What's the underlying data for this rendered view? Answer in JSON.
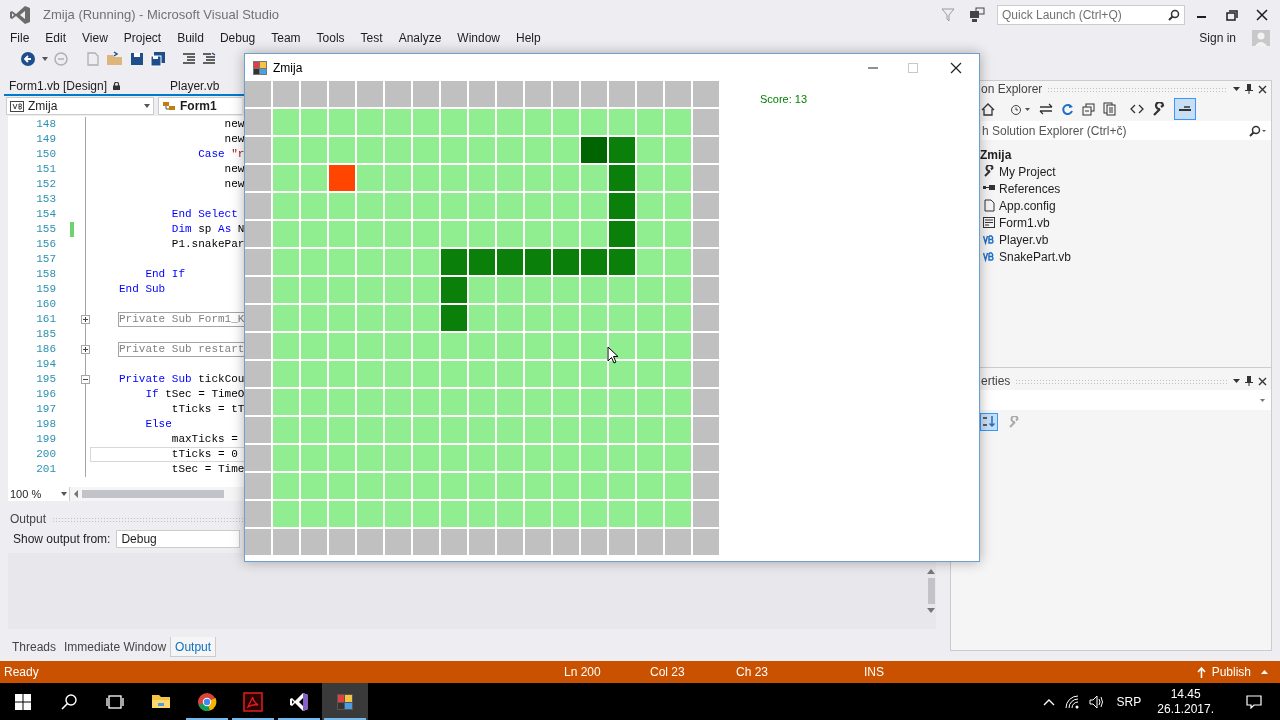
{
  "ide": {
    "title": "Zmija (Running) - Microsoft Visual Studio",
    "quick_launch": {
      "placeholder": "Quick Launch (Ctrl+Q)"
    },
    "menu": [
      "File",
      "Edit",
      "View",
      "Project",
      "Build",
      "Debug",
      "Team",
      "Tools",
      "Test",
      "Analyze",
      "Window",
      "Help"
    ],
    "sign_in": "Sign in"
  },
  "document_tabs": [
    {
      "label": "Form1.vb [Design]",
      "locked": true
    },
    {
      "label": "Player.vb",
      "locked": false
    }
  ],
  "navigation": {
    "project": "Zmija",
    "type": "Form1"
  },
  "code_lines": [
    {
      "number": "148",
      "kind": "code",
      "changed": false,
      "current": false,
      "segments": [
        {
          "kind": "plain",
          "text": "                new"
        }
      ]
    },
    {
      "number": "149",
      "kind": "code",
      "changed": false,
      "current": false,
      "segments": [
        {
          "kind": "plain",
          "text": "                new"
        }
      ]
    },
    {
      "number": "150",
      "kind": "code",
      "changed": false,
      "current": false,
      "segments": [
        {
          "kind": "kw",
          "text": "            Case "
        },
        {
          "kind": "string",
          "text": "\"r"
        }
      ]
    },
    {
      "number": "151",
      "kind": "code",
      "changed": false,
      "current": false,
      "segments": [
        {
          "kind": "plain",
          "text": "                new"
        }
      ]
    },
    {
      "number": "152",
      "kind": "code",
      "changed": false,
      "current": false,
      "segments": [
        {
          "kind": "plain",
          "text": "                new"
        }
      ]
    },
    {
      "number": "153",
      "kind": "code",
      "changed": false,
      "current": false
    },
    {
      "number": "154",
      "kind": "code",
      "changed": false,
      "current": false,
      "segments": [
        {
          "kind": "kw",
          "text": "        End Select"
        }
      ]
    },
    {
      "number": "155",
      "kind": "code",
      "changed": true,
      "current": false,
      "segments": [
        {
          "kind": "kw",
          "text": "        Dim"
        },
        {
          "kind": "plain",
          "text": " sp "
        },
        {
          "kind": "kw",
          "text": "As"
        },
        {
          "kind": "plain",
          "text": " N"
        }
      ]
    },
    {
      "number": "156",
      "kind": "code",
      "changed": false,
      "current": false,
      "segments": [
        {
          "kind": "plain",
          "text": "        P1.snakePar"
        }
      ]
    },
    {
      "number": "157",
      "kind": "code",
      "changed": false,
      "current": false
    },
    {
      "number": "158",
      "kind": "code",
      "changed": false,
      "current": false,
      "segments": [
        {
          "kind": "kw",
          "text": "    End If"
        }
      ]
    },
    {
      "number": "159",
      "kind": "code",
      "changed": false,
      "current": false,
      "segments": [
        {
          "kind": "kw",
          "text": "End Sub"
        }
      ]
    },
    {
      "number": "160",
      "kind": "code",
      "changed": false,
      "current": false
    },
    {
      "number": "161",
      "kind": "collapsed",
      "changed": false,
      "current": false,
      "text": "Private Sub Form1_K"
    },
    {
      "number": "185",
      "kind": "code",
      "changed": false,
      "current": false
    },
    {
      "number": "186",
      "kind": "collapsed",
      "changed": false,
      "current": false,
      "text": "Private Sub restart"
    },
    {
      "number": "194",
      "kind": "code",
      "changed": false,
      "current": false
    },
    {
      "number": "195",
      "kind": "region",
      "changed": false,
      "current": false,
      "segments": [
        {
          "kind": "kw",
          "text": "Private Sub"
        },
        {
          "kind": "plain",
          "text": " tickCou"
        }
      ]
    },
    {
      "number": "196",
      "kind": "code",
      "changed": false,
      "current": false,
      "segments": [
        {
          "kind": "kw",
          "text": "    If"
        },
        {
          "kind": "plain",
          "text": " tSec = TimeO"
        }
      ]
    },
    {
      "number": "197",
      "kind": "code",
      "changed": false,
      "current": false,
      "segments": [
        {
          "kind": "plain",
          "text": "        tTicks = tT"
        }
      ]
    },
    {
      "number": "198",
      "kind": "code",
      "changed": false,
      "current": false,
      "segments": [
        {
          "kind": "kw",
          "text": "    Else"
        }
      ]
    },
    {
      "number": "199",
      "kind": "code",
      "changed": false,
      "current": false,
      "segments": [
        {
          "kind": "plain",
          "text": "        maxTicks ="
        }
      ]
    },
    {
      "number": "200",
      "kind": "code",
      "changed": false,
      "current": true,
      "segments": [
        {
          "kind": "plain",
          "text": "        tTicks = 0"
        }
      ]
    },
    {
      "number": "201",
      "kind": "code",
      "changed": false,
      "current": false,
      "segments": [
        {
          "kind": "plain",
          "text": "        tSec = Time"
        }
      ]
    }
  ],
  "zoom": "100 %",
  "output": {
    "title": "Output",
    "source_label": "Show output from:",
    "source": "Debug"
  },
  "bottom_tabs": [
    {
      "label": "Threads",
      "selected": false
    },
    {
      "label": "Immediate Window",
      "selected": false
    },
    {
      "label": "Output",
      "selected": true
    }
  ],
  "solution_explorer": {
    "title": "on Explorer",
    "search": {
      "placeholder": "h Solution Explorer (Ctrl+č)"
    },
    "tree": {
      "label": "Zmija",
      "children": [
        {
          "label": "My Project",
          "kind": "settings"
        },
        {
          "label": "References",
          "kind": "references"
        },
        {
          "label": "App.config",
          "kind": "config"
        },
        {
          "label": "Form1.vb",
          "kind": "form"
        },
        {
          "label": "Player.vb",
          "kind": "vb"
        },
        {
          "label": "SnakePart.vb",
          "kind": "vb"
        }
      ]
    }
  },
  "properties": {
    "title": "erties"
  },
  "status_bar": {
    "text": "Ready",
    "line": "Ln 200",
    "column": "Col 23",
    "char": "Ch 23",
    "mode": "INS",
    "publish": "Publish"
  },
  "taskbar": {
    "apps": [
      {
        "kind": "explorer",
        "running": false,
        "active": false
      },
      {
        "kind": "chrome",
        "running": true,
        "active": false
      },
      {
        "kind": "acrobat",
        "running": true,
        "active": false
      },
      {
        "kind": "visualstudio",
        "running": true,
        "active": false
      },
      {
        "kind": "snake",
        "running": true,
        "active": true
      }
    ],
    "language": "SRP",
    "time": "14.45",
    "date": "26.1.2017."
  },
  "game_window": {
    "title": "Zmija",
    "score": "Score: 13",
    "board": [
      {
        "cells": [
          {
            "kind": "wall"
          },
          {
            "kind": "wall"
          },
          {
            "kind": "wall"
          },
          {
            "kind": "wall"
          },
          {
            "kind": "wall"
          },
          {
            "kind": "wall"
          },
          {
            "kind": "wall"
          },
          {
            "kind": "wall"
          },
          {
            "kind": "wall"
          },
          {
            "kind": "wall"
          },
          {
            "kind": "wall"
          },
          {
            "kind": "wall"
          },
          {
            "kind": "wall"
          },
          {
            "kind": "wall"
          },
          {
            "kind": "wall"
          },
          {
            "kind": "wall"
          },
          {
            "kind": "wall"
          }
        ]
      },
      {
        "cells": [
          {
            "kind": "wall"
          },
          {
            "kind": "grass"
          },
          {
            "kind": "grass"
          },
          {
            "kind": "grass"
          },
          {
            "kind": "grass"
          },
          {
            "kind": "grass"
          },
          {
            "kind": "grass"
          },
          {
            "kind": "grass"
          },
          {
            "kind": "grass"
          },
          {
            "kind": "grass"
          },
          {
            "kind": "grass"
          },
          {
            "kind": "grass"
          },
          {
            "kind": "grass"
          },
          {
            "kind": "grass"
          },
          {
            "kind": "grass"
          },
          {
            "kind": "grass"
          },
          {
            "kind": "wall"
          }
        ]
      },
      {
        "cells": [
          {
            "kind": "wall"
          },
          {
            "kind": "grass"
          },
          {
            "kind": "grass"
          },
          {
            "kind": "grass"
          },
          {
            "kind": "grass"
          },
          {
            "kind": "grass"
          },
          {
            "kind": "grass"
          },
          {
            "kind": "grass"
          },
          {
            "kind": "grass"
          },
          {
            "kind": "grass"
          },
          {
            "kind": "grass"
          },
          {
            "kind": "grass"
          },
          {
            "kind": "head"
          },
          {
            "kind": "snake"
          },
          {
            "kind": "grass"
          },
          {
            "kind": "grass"
          },
          {
            "kind": "wall"
          }
        ]
      },
      {
        "cells": [
          {
            "kind": "wall"
          },
          {
            "kind": "grass"
          },
          {
            "kind": "grass"
          },
          {
            "kind": "food"
          },
          {
            "kind": "grass"
          },
          {
            "kind": "grass"
          },
          {
            "kind": "grass"
          },
          {
            "kind": "grass"
          },
          {
            "kind": "grass"
          },
          {
            "kind": "grass"
          },
          {
            "kind": "grass"
          },
          {
            "kind": "grass"
          },
          {
            "kind": "grass"
          },
          {
            "kind": "snake"
          },
          {
            "kind": "grass"
          },
          {
            "kind": "grass"
          },
          {
            "kind": "wall"
          }
        ]
      },
      {
        "cells": [
          {
            "kind": "wall"
          },
          {
            "kind": "grass"
          },
          {
            "kind": "grass"
          },
          {
            "kind": "grass"
          },
          {
            "kind": "grass"
          },
          {
            "kind": "grass"
          },
          {
            "kind": "grass"
          },
          {
            "kind": "grass"
          },
          {
            "kind": "grass"
          },
          {
            "kind": "grass"
          },
          {
            "kind": "grass"
          },
          {
            "kind": "grass"
          },
          {
            "kind": "grass"
          },
          {
            "kind": "snake"
          },
          {
            "kind": "grass"
          },
          {
            "kind": "grass"
          },
          {
            "kind": "wall"
          }
        ]
      },
      {
        "cells": [
          {
            "kind": "wall"
          },
          {
            "kind": "grass"
          },
          {
            "kind": "grass"
          },
          {
            "kind": "grass"
          },
          {
            "kind": "grass"
          },
          {
            "kind": "grass"
          },
          {
            "kind": "grass"
          },
          {
            "kind": "grass"
          },
          {
            "kind": "grass"
          },
          {
            "kind": "grass"
          },
          {
            "kind": "grass"
          },
          {
            "kind": "grass"
          },
          {
            "kind": "grass"
          },
          {
            "kind": "snake"
          },
          {
            "kind": "grass"
          },
          {
            "kind": "grass"
          },
          {
            "kind": "wall"
          }
        ]
      },
      {
        "cells": [
          {
            "kind": "wall"
          },
          {
            "kind": "grass"
          },
          {
            "kind": "grass"
          },
          {
            "kind": "grass"
          },
          {
            "kind": "grass"
          },
          {
            "kind": "grass"
          },
          {
            "kind": "grass"
          },
          {
            "kind": "snake"
          },
          {
            "kind": "snake"
          },
          {
            "kind": "snake"
          },
          {
            "kind": "snake"
          },
          {
            "kind": "snake"
          },
          {
            "kind": "snake"
          },
          {
            "kind": "snake"
          },
          {
            "kind": "grass"
          },
          {
            "kind": "grass"
          },
          {
            "kind": "wall"
          }
        ]
      },
      {
        "cells": [
          {
            "kind": "wall"
          },
          {
            "kind": "grass"
          },
          {
            "kind": "grass"
          },
          {
            "kind": "grass"
          },
          {
            "kind": "grass"
          },
          {
            "kind": "grass"
          },
          {
            "kind": "grass"
          },
          {
            "kind": "snake"
          },
          {
            "kind": "grass"
          },
          {
            "kind": "grass"
          },
          {
            "kind": "grass"
          },
          {
            "kind": "grass"
          },
          {
            "kind": "grass"
          },
          {
            "kind": "grass"
          },
          {
            "kind": "grass"
          },
          {
            "kind": "grass"
          },
          {
            "kind": "wall"
          }
        ]
      },
      {
        "cells": [
          {
            "kind": "wall"
          },
          {
            "kind": "grass"
          },
          {
            "kind": "grass"
          },
          {
            "kind": "grass"
          },
          {
            "kind": "grass"
          },
          {
            "kind": "grass"
          },
          {
            "kind": "grass"
          },
          {
            "kind": "snake"
          },
          {
            "kind": "grass"
          },
          {
            "kind": "grass"
          },
          {
            "kind": "grass"
          },
          {
            "kind": "grass"
          },
          {
            "kind": "grass"
          },
          {
            "kind": "grass"
          },
          {
            "kind": "grass"
          },
          {
            "kind": "grass"
          },
          {
            "kind": "wall"
          }
        ]
      },
      {
        "cells": [
          {
            "kind": "wall"
          },
          {
            "kind": "grass"
          },
          {
            "kind": "grass"
          },
          {
            "kind": "grass"
          },
          {
            "kind": "grass"
          },
          {
            "kind": "grass"
          },
          {
            "kind": "grass"
          },
          {
            "kind": "grass"
          },
          {
            "kind": "grass"
          },
          {
            "kind": "grass"
          },
          {
            "kind": "grass"
          },
          {
            "kind": "grass"
          },
          {
            "kind": "grass"
          },
          {
            "kind": "grass"
          },
          {
            "kind": "grass"
          },
          {
            "kind": "grass"
          },
          {
            "kind": "wall"
          }
        ]
      },
      {
        "cells": [
          {
            "kind": "wall"
          },
          {
            "kind": "grass"
          },
          {
            "kind": "grass"
          },
          {
            "kind": "grass"
          },
          {
            "kind": "grass"
          },
          {
            "kind": "grass"
          },
          {
            "kind": "grass"
          },
          {
            "kind": "grass"
          },
          {
            "kind": "grass"
          },
          {
            "kind": "grass"
          },
          {
            "kind": "grass"
          },
          {
            "kind": "grass"
          },
          {
            "kind": "grass"
          },
          {
            "kind": "grass"
          },
          {
            "kind": "grass"
          },
          {
            "kind": "grass"
          },
          {
            "kind": "wall"
          }
        ]
      },
      {
        "cells": [
          {
            "kind": "wall"
          },
          {
            "kind": "grass"
          },
          {
            "kind": "grass"
          },
          {
            "kind": "grass"
          },
          {
            "kind": "grass"
          },
          {
            "kind": "grass"
          },
          {
            "kind": "grass"
          },
          {
            "kind": "grass"
          },
          {
            "kind": "grass"
          },
          {
            "kind": "grass"
          },
          {
            "kind": "grass"
          },
          {
            "kind": "grass"
          },
          {
            "kind": "grass"
          },
          {
            "kind": "grass"
          },
          {
            "kind": "grass"
          },
          {
            "kind": "grass"
          },
          {
            "kind": "wall"
          }
        ]
      },
      {
        "cells": [
          {
            "kind": "wall"
          },
          {
            "kind": "grass"
          },
          {
            "kind": "grass"
          },
          {
            "kind": "grass"
          },
          {
            "kind": "grass"
          },
          {
            "kind": "grass"
          },
          {
            "kind": "grass"
          },
          {
            "kind": "grass"
          },
          {
            "kind": "grass"
          },
          {
            "kind": "grass"
          },
          {
            "kind": "grass"
          },
          {
            "kind": "grass"
          },
          {
            "kind": "grass"
          },
          {
            "kind": "grass"
          },
          {
            "kind": "grass"
          },
          {
            "kind": "grass"
          },
          {
            "kind": "wall"
          }
        ]
      },
      {
        "cells": [
          {
            "kind": "wall"
          },
          {
            "kind": "grass"
          },
          {
            "kind": "grass"
          },
          {
            "kind": "grass"
          },
          {
            "kind": "grass"
          },
          {
            "kind": "grass"
          },
          {
            "kind": "grass"
          },
          {
            "kind": "grass"
          },
          {
            "kind": "grass"
          },
          {
            "kind": "grass"
          },
          {
            "kind": "grass"
          },
          {
            "kind": "grass"
          },
          {
            "kind": "grass"
          },
          {
            "kind": "grass"
          },
          {
            "kind": "grass"
          },
          {
            "kind": "grass"
          },
          {
            "kind": "wall"
          }
        ]
      },
      {
        "cells": [
          {
            "kind": "wall"
          },
          {
            "kind": "grass"
          },
          {
            "kind": "grass"
          },
          {
            "kind": "grass"
          },
          {
            "kind": "grass"
          },
          {
            "kind": "grass"
          },
          {
            "kind": "grass"
          },
          {
            "kind": "grass"
          },
          {
            "kind": "grass"
          },
          {
            "kind": "grass"
          },
          {
            "kind": "grass"
          },
          {
            "kind": "grass"
          },
          {
            "kind": "grass"
          },
          {
            "kind": "grass"
          },
          {
            "kind": "grass"
          },
          {
            "kind": "grass"
          },
          {
            "kind": "wall"
          }
        ]
      },
      {
        "cells": [
          {
            "kind": "wall"
          },
          {
            "kind": "grass"
          },
          {
            "kind": "grass"
          },
          {
            "kind": "grass"
          },
          {
            "kind": "grass"
          },
          {
            "kind": "grass"
          },
          {
            "kind": "grass"
          },
          {
            "kind": "grass"
          },
          {
            "kind": "grass"
          },
          {
            "kind": "grass"
          },
          {
            "kind": "grass"
          },
          {
            "kind": "grass"
          },
          {
            "kind": "grass"
          },
          {
            "kind": "grass"
          },
          {
            "kind": "grass"
          },
          {
            "kind": "grass"
          },
          {
            "kind": "wall"
          }
        ]
      },
      {
        "cells": [
          {
            "kind": "wall"
          },
          {
            "kind": "wall"
          },
          {
            "kind": "wall"
          },
          {
            "kind": "wall"
          },
          {
            "kind": "wall"
          },
          {
            "kind": "wall"
          },
          {
            "kind": "wall"
          },
          {
            "kind": "wall"
          },
          {
            "kind": "wall"
          },
          {
            "kind": "wall"
          },
          {
            "kind": "wall"
          },
          {
            "kind": "wall"
          },
          {
            "kind": "wall"
          },
          {
            "kind": "wall"
          },
          {
            "kind": "wall"
          },
          {
            "kind": "wall"
          },
          {
            "kind": "wall"
          }
        ]
      }
    ]
  }
}
